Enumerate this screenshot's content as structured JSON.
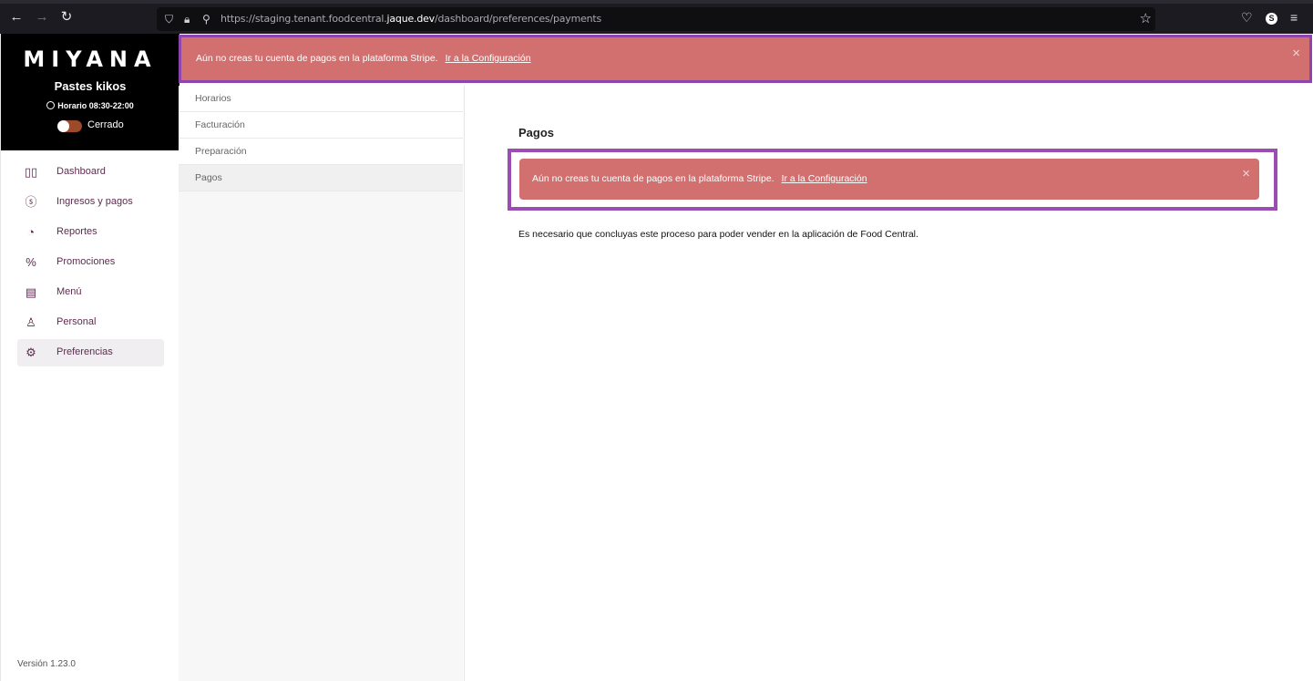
{
  "browser": {
    "url_prefix": "https://staging.tenant.foodcentral.",
    "url_domain": "jaque.dev",
    "url_path": "/dashboard/preferences/payments",
    "back_icon": "arrow-left-icon",
    "forward_icon": "arrow-right-icon",
    "reload_icon": "reload-icon",
    "avatar_letter": "S"
  },
  "brand": {
    "logo": "MIYANA",
    "store_name": "Pastes kikos",
    "hours": "Horario 08:30-22:00",
    "status": "Cerrado",
    "is_open": false
  },
  "sidebar": {
    "items": [
      {
        "label": "Dashboard",
        "icon": "dashboard-icon"
      },
      {
        "label": "Ingresos y pagos",
        "icon": "dollar-icon"
      },
      {
        "label": "Reportes",
        "icon": "pie-chart-icon"
      },
      {
        "label": "Promociones",
        "icon": "percent-icon"
      },
      {
        "label": "Menú",
        "icon": "menu-doc-icon"
      },
      {
        "label": "Personal",
        "icon": "staff-icon"
      },
      {
        "label": "Preferencias",
        "icon": "gear-icon"
      }
    ],
    "active": "Preferencias",
    "version": "Versión 1.23.0"
  },
  "alert": {
    "message": "Aún no creas tu cuenta de pagos en la plataforma Stripe.",
    "link": "Ir a la Configuración",
    "close": "×"
  },
  "subnav": {
    "items": [
      "Horarios",
      "Facturación",
      "Preparación",
      "Pagos"
    ],
    "active": "Pagos"
  },
  "main": {
    "title": "Pagos",
    "body": "Es necesario que concluyas este proceso para poder vender en la aplicación de Food Central."
  },
  "colors": {
    "alert_bg": "#d27070",
    "highlight_border": "#8e44ad",
    "brand_accent": "#5d2c4f"
  }
}
